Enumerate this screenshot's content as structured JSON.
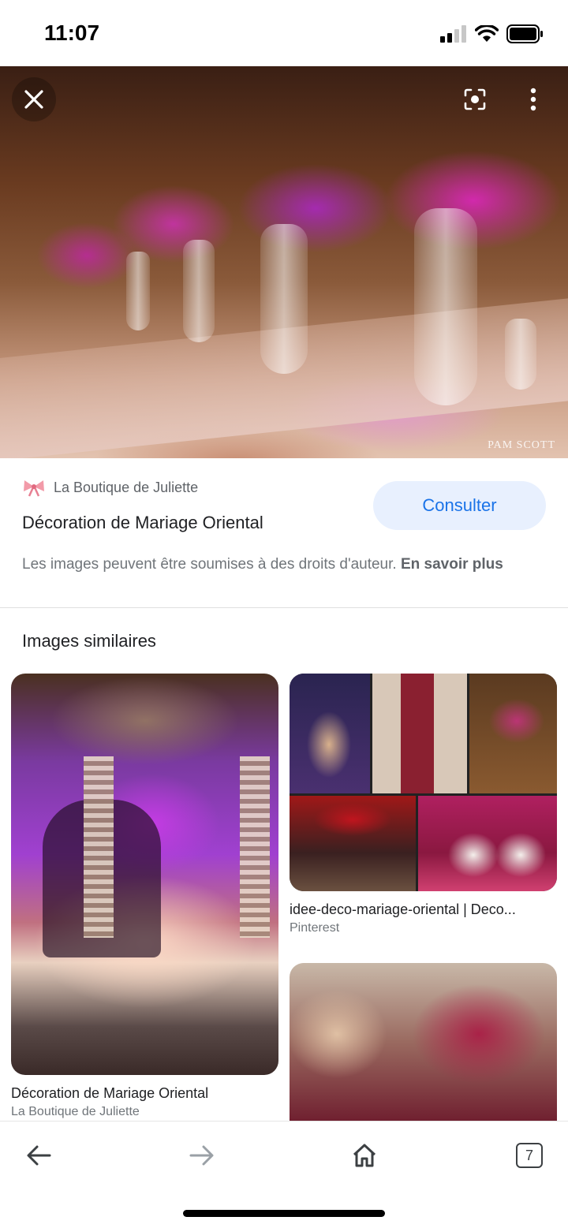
{
  "status_bar": {
    "time": "11:07",
    "icons": [
      "signal-icon",
      "wifi-icon",
      "battery-icon"
    ]
  },
  "hero": {
    "watermark": "PAM SCOTT",
    "icons": [
      "close-icon",
      "lens-icon",
      "more-vert-icon"
    ]
  },
  "result": {
    "source_name": "La Boutique de Juliette",
    "title": "Décoration de Mariage Oriental",
    "visit_label": "Consulter",
    "copyright_text": "Les images peuvent être soumises à des droits d'auteur. ",
    "copyright_link": "En savoir plus"
  },
  "similar": {
    "section_title": "Images similaires",
    "items": [
      {
        "title": "Décoration de Mariage Oriental",
        "source": "La Boutique de Juliette"
      },
      {
        "title": "idee-deco-mariage-oriental | Deco...",
        "source": "Pinterest"
      },
      {
        "title": "",
        "source": ""
      }
    ]
  },
  "bottom_nav": {
    "tab_count": "7",
    "icons": [
      "back-arrow-icon",
      "forward-arrow-icon",
      "home-icon",
      "tabs-icon"
    ]
  },
  "colors": {
    "accent": "#1a73e8",
    "visit_button_bg": "#e8f0fe"
  }
}
